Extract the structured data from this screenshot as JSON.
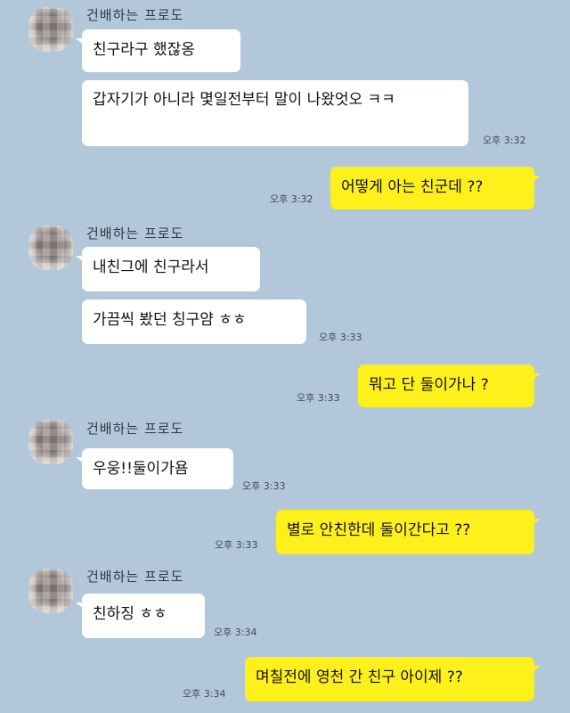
{
  "messages": [
    {
      "type": "in",
      "sender": "건배하는 프로도",
      "texts": [
        "친구라구 했잖옹",
        "갑자기가 아니라 몇일전부터 말이 나왔엇오 ㅋㅋ"
      ],
      "time": "오후 3:32"
    },
    {
      "type": "out",
      "text": "어떻게 아는 친군데 ??",
      "time": "오후 3:32"
    },
    {
      "type": "in",
      "sender": "건배하는 프로도",
      "texts": [
        "내친그에 친구라서",
        "가끔씩 봤던 칭구얌 ㅎㅎ"
      ],
      "time": "오후 3:33"
    },
    {
      "type": "out",
      "text": "뭐고 단 둘이가나 ?",
      "time": "오후 3:33"
    },
    {
      "type": "in",
      "sender": "건배하는 프로도",
      "texts": [
        "우웅!!둘이가욤"
      ],
      "time": "오후 3:33"
    },
    {
      "type": "out",
      "text": "별로 안친한데 둘이간다고 ??",
      "time": "오후 3:33"
    },
    {
      "type": "in",
      "sender": "건배하는 프로도",
      "texts": [
        "친하징 ㅎㅎ"
      ],
      "time": "오후 3:34"
    },
    {
      "type": "out",
      "text": "며칠전에 영천 간 친구 아이제 ??",
      "time": "오후 3:34"
    }
  ]
}
